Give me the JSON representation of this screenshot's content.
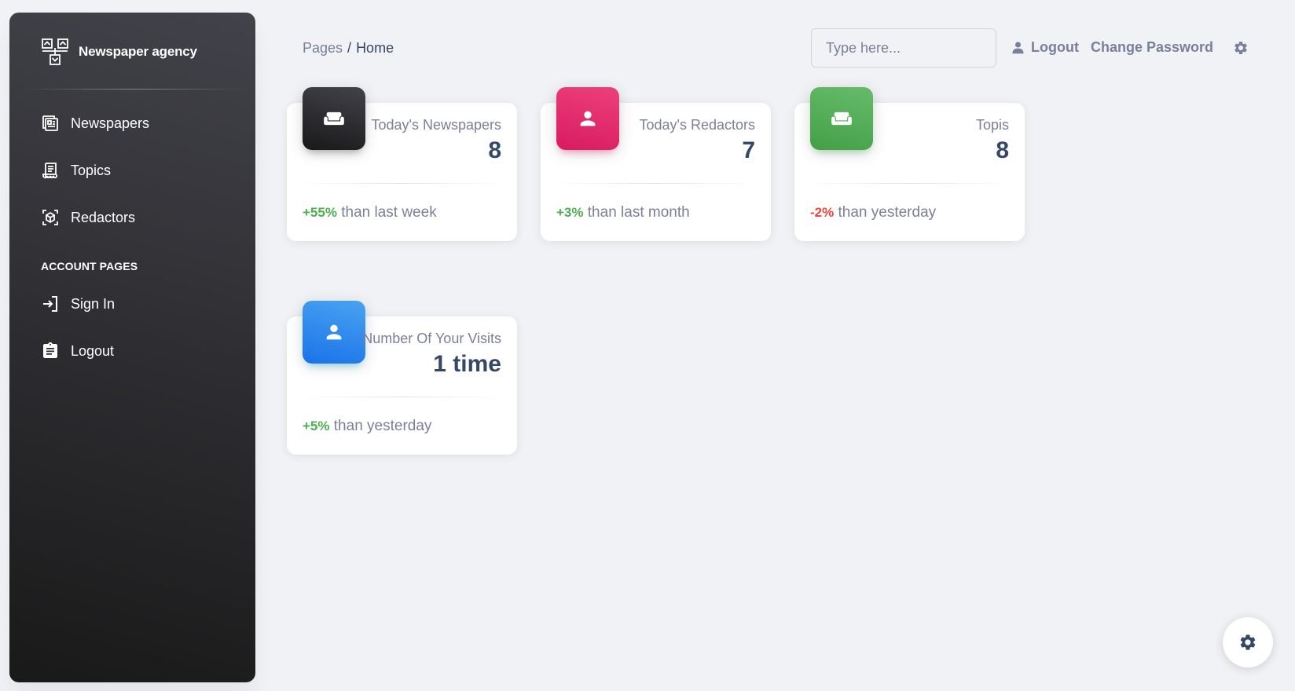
{
  "colors": {
    "sidebar_gradient": [
      "#42424a",
      "#191919"
    ],
    "positive": "#4caf50",
    "negative": "#f44335",
    "text_dark": "#344767",
    "text_muted": "#7b809a",
    "background": "#f0f2f5"
  },
  "sidebar": {
    "brand": {
      "icon": "network-logo-icon",
      "title": "Newspaper agency"
    },
    "items": [
      {
        "label": "Newspapers",
        "icon": "newspaper-icon"
      },
      {
        "label": "Topics",
        "icon": "receipt-icon"
      },
      {
        "label": "Redactors",
        "icon": "cube-scan-icon"
      }
    ],
    "section_title": "ACCOUNT PAGES",
    "account_items": [
      {
        "label": "Sign In",
        "icon": "login-icon"
      },
      {
        "label": "Logout",
        "icon": "clipboard-icon"
      }
    ]
  },
  "header": {
    "breadcrumb": {
      "parent": "Pages",
      "separator": "/",
      "current": "Home"
    },
    "search": {
      "placeholder": "Type here...",
      "value": ""
    },
    "logout_label": "Logout",
    "change_password_label": "Change Password",
    "settings_icon": "gear-icon"
  },
  "cards": [
    {
      "label": "Today's Newspapers",
      "value": "8",
      "delta": "+55%",
      "delta_type": "positive",
      "footer": "than last week",
      "icon": "weekend-icon",
      "icon_color": "dark"
    },
    {
      "label": "Today's Redactors",
      "value": "7",
      "delta": "+3%",
      "delta_type": "positive",
      "footer": "than last month",
      "icon": "person-icon",
      "icon_color": "pink"
    },
    {
      "label": "Topis",
      "value": "8",
      "delta": "-2%",
      "delta_type": "negative",
      "footer": "than yesterday",
      "icon": "weekend-icon",
      "icon_color": "green"
    },
    {
      "label": "Number Of Your Visits",
      "value": "1 time",
      "delta": "+5%",
      "delta_type": "positive",
      "footer": "than yesterday",
      "icon": "person-icon",
      "icon_color": "blue"
    }
  ],
  "fab": {
    "icon": "gear-icon"
  }
}
